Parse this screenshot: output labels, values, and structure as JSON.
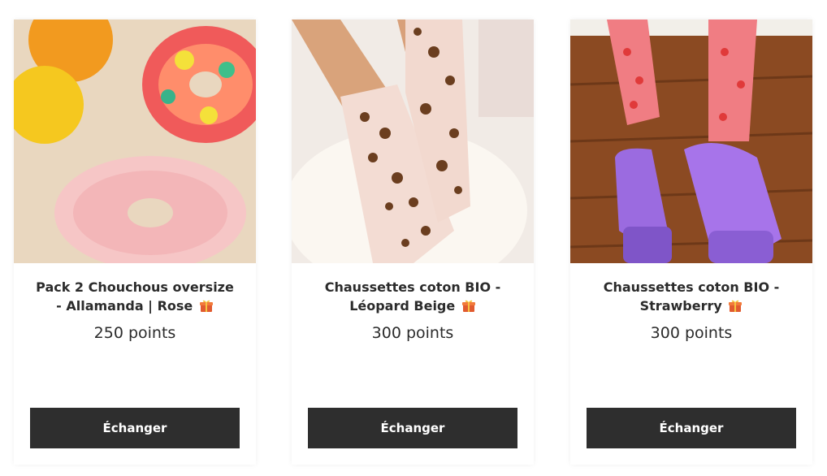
{
  "products": [
    {
      "title_line1": "Pack 2 Chouchous oversize",
      "title_line2": "- Allamanda | Rose",
      "points": "250 points",
      "button": "Échanger",
      "image_icon": "scrunchies-photo"
    },
    {
      "title_line1": "Chaussettes coton BIO -",
      "title_line2": "Léopard Beige",
      "points": "300 points",
      "button": "Échanger",
      "image_icon": "leopard-socks-photo"
    },
    {
      "title_line1": "Chaussettes coton BIO -",
      "title_line2": "Strawberry",
      "points": "300 points",
      "button": "Échanger",
      "image_icon": "strawberry-socks-photo"
    }
  ],
  "icons": {
    "gift": "gift-icon"
  },
  "colors": {
    "button_bg": "#2e2e2e",
    "button_text": "#ffffff",
    "text": "#2b2b2b"
  }
}
